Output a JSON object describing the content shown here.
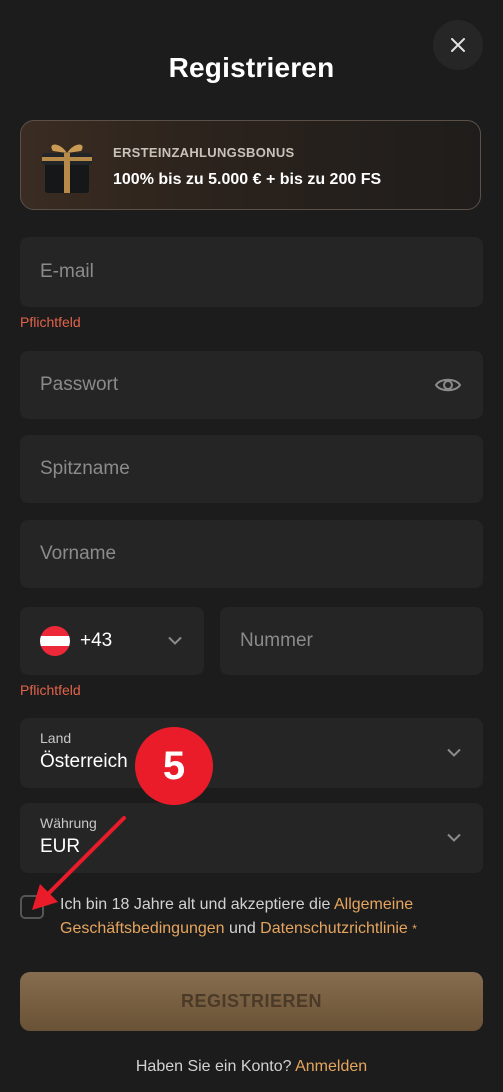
{
  "title": "Registrieren",
  "bonus": {
    "label": "ERSTEINZAHLUNGSBONUS",
    "text": "100% bis zu 5.000 € + bis zu 200 FS"
  },
  "fields": {
    "email_placeholder": "E-mail",
    "email_error": "Pflichtfeld",
    "password_placeholder": "Passwort",
    "nickname_placeholder": "Spitzname",
    "firstname_placeholder": "Vorname",
    "phone_code": "+43",
    "phone_placeholder": "Nummer",
    "phone_error": "Pflichtfeld",
    "country_label": "Land",
    "country_value": "Österreich",
    "currency_label": "Währung",
    "currency_value": "EUR"
  },
  "annotation": {
    "badge_number": "5"
  },
  "terms": {
    "text_before": "Ich bin 18 Jahre alt und akzeptiere die ",
    "link1": "Allgemeine Geschäftsbedingungen",
    "text_mid": " und ",
    "link2": "Datenschutzrichtlinie",
    "required_mark": "*"
  },
  "submit_label": "REGISTRIEREN",
  "footer": {
    "text": "Haben Sie ein Konto? ",
    "link": "Anmelden"
  },
  "colors": {
    "accent": "#e5a55e",
    "error": "#e0644a",
    "badge": "#ea1c2a",
    "background": "#1c1c1c",
    "field": "#252525"
  },
  "icons": {
    "close": "close-icon",
    "eye": "eye-icon",
    "chevron": "chevron-down-icon",
    "gift": "gift-icon",
    "flag": "austria-flag-icon"
  }
}
